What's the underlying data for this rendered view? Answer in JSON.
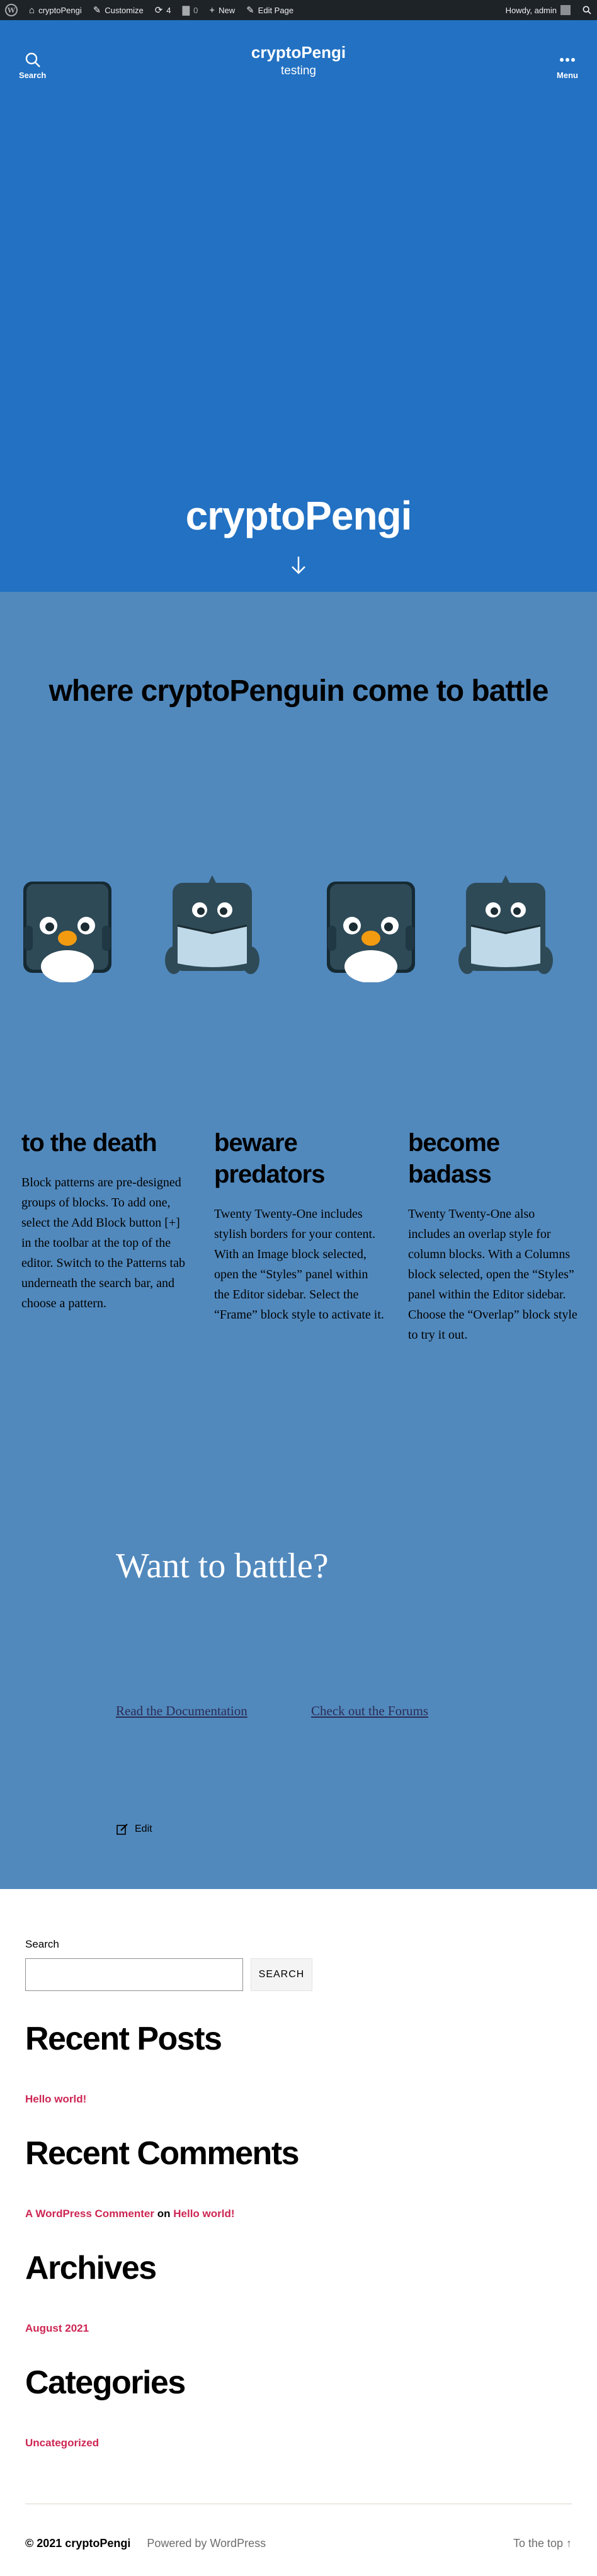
{
  "admin_bar": {
    "site_name": "cryptoPengi",
    "customize": "Customize",
    "updates_count": "4",
    "comments_count": "0",
    "new": "New",
    "edit_page": "Edit Page",
    "greeting": "Howdy, admin"
  },
  "header": {
    "site_title": "cryptoPengi",
    "site_description": "testing",
    "search_label": "Search",
    "menu_label": "Menu"
  },
  "cover": {
    "title": "cryptoPengi"
  },
  "main": {
    "heading": "where cryptoPenguin come to battle",
    "columns": [
      {
        "title": "to the death",
        "text": "Block patterns are pre-designed groups of blocks. To add one, select the Add Block button [+] in the toolbar at the top of the editor. Switch to the Patterns tab underneath the search bar, and choose a pattern."
      },
      {
        "title": "beware predators",
        "text": "Twenty Twenty-One includes stylish borders for your content. With an Image block selected, open the “Styles” panel within the Editor sidebar. Select the “Frame” block style to activate it."
      },
      {
        "title": "become badass",
        "text": "Twenty Twenty-One also includes an overlap style for column blocks. With a Columns block selected, open the “Styles” panel within the Editor sidebar. Choose the “Overlap” block style to try it out."
      }
    ],
    "cta_title": "Want to battle?",
    "link_docs": "Read the Documentation",
    "link_forums": "Check out the Forums",
    "edit": "Edit"
  },
  "widgets": {
    "search_label": "Search",
    "search_button": "SEARCH",
    "recent_posts_title": "Recent Posts",
    "recent_post": "Hello world!",
    "recent_comments_title": "Recent Comments",
    "commenter": "A WordPress Commenter",
    "comment_on": "on",
    "comment_post": "Hello world!",
    "archives_title": "Archives",
    "archive_item": "August 2021",
    "categories_title": "Categories",
    "category_item": "Uncategorized"
  },
  "footer": {
    "copyright": "© 2021 cryptoPengi",
    "powered_by": "Powered by WordPress",
    "to_top": "To the top ↑"
  },
  "colors": {
    "admin_bar": "#1d2327",
    "header_blue": "#2271c3",
    "content_blue": "#5189bd",
    "accent_link": "#cd2653",
    "penguin_body": "#2e4a57",
    "penguin_belly": "#bfd9e8",
    "beak": "#f29b11"
  }
}
